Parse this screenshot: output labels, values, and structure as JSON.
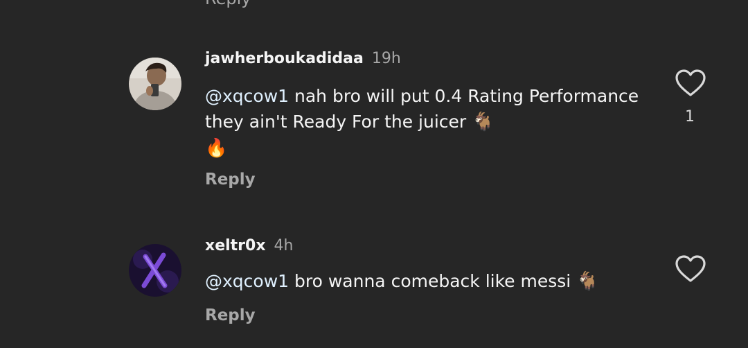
{
  "previous_reply_label": "Reply",
  "comments": [
    {
      "username": "jawherboukadidaa",
      "time": "19h",
      "mention": "@xqcow1",
      "text": " nah bro will put 0.4 Rating Performance they ain't Ready For the juicer ",
      "emojis": [
        "goat-emoji",
        "fire-emoji"
      ],
      "reply_label": "Reply",
      "like_count": "1"
    },
    {
      "username": "xeltr0x",
      "time": "4h",
      "mention": "@xqcow1",
      "text": " bro wanna comeback like messi ",
      "emojis": [
        "goat-emoji"
      ],
      "reply_label": "Reply",
      "like_count": ""
    }
  ],
  "colors": {
    "background": "#262626",
    "text_primary": "#f5f5f5",
    "text_secondary": "#a8a8a8"
  },
  "icons": [
    "heart-outline-icon"
  ]
}
